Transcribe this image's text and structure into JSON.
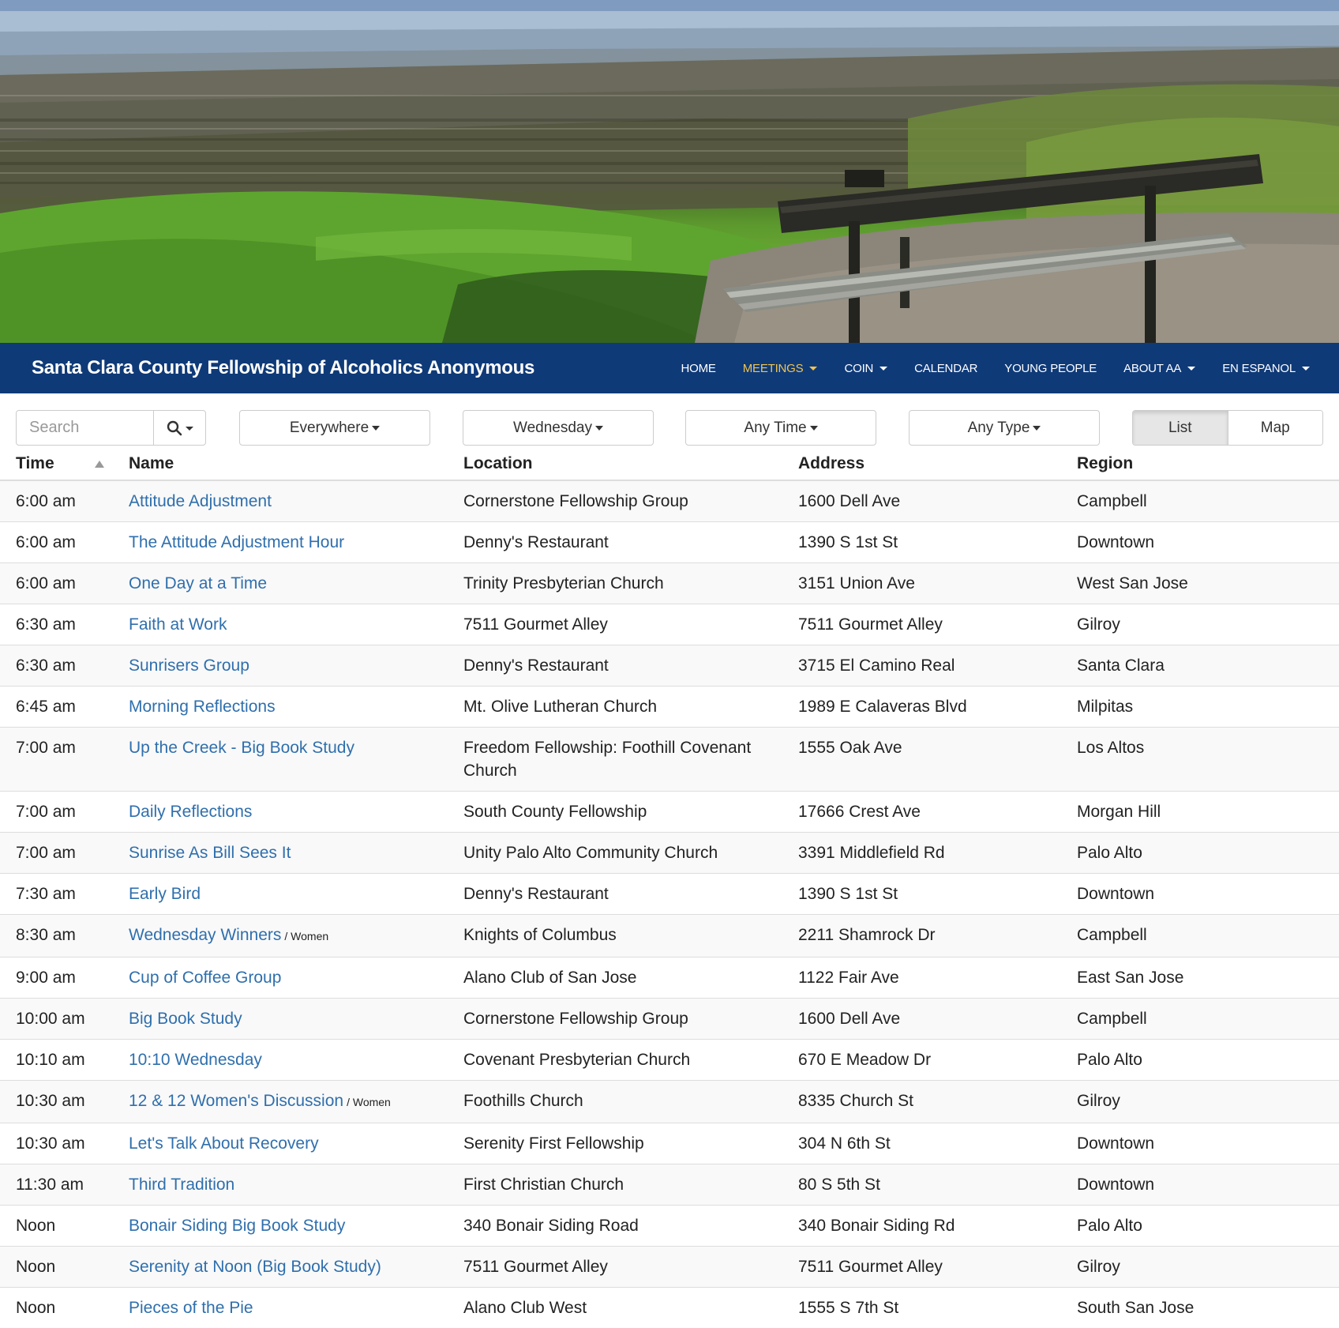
{
  "brand": {
    "title": "Santa Clara County Fellowship of Alcoholics Anonymous"
  },
  "nav": {
    "items": [
      {
        "label": "HOME",
        "dropdown": false,
        "active": false
      },
      {
        "label": "MEETINGS",
        "dropdown": true,
        "active": true
      },
      {
        "label": "COIN",
        "dropdown": true,
        "active": false
      },
      {
        "label": "CALENDAR",
        "dropdown": false,
        "active": false
      },
      {
        "label": "YOUNG PEOPLE",
        "dropdown": false,
        "active": false
      },
      {
        "label": "ABOUT AA",
        "dropdown": true,
        "active": false
      },
      {
        "label": "EN ESPANOL",
        "dropdown": true,
        "active": false
      }
    ],
    "active_color": "#f0c451",
    "bar_color": "#0f3a78"
  },
  "controls": {
    "search_placeholder": "Search",
    "search_icon": "search-icon",
    "region_filter": "Everywhere",
    "day_filter": "Wednesday",
    "time_filter": "Any Time",
    "type_filter": "Any Type",
    "view_list": "List",
    "view_map": "Map",
    "active_view": "List"
  },
  "table": {
    "headers": {
      "time": "Time",
      "name": "Name",
      "location": "Location",
      "address": "Address",
      "region": "Region"
    },
    "sorted_by": "time",
    "link_color": "#2f6fad",
    "rows": [
      {
        "time": "6:00 am",
        "name": "Attitude Adjustment",
        "attr": "",
        "location": "Cornerstone Fellowship Group",
        "address": "1600 Dell Ave",
        "region": "Campbell"
      },
      {
        "time": "6:00 am",
        "name": "The Attitude Adjustment Hour",
        "attr": "",
        "location": "Denny's Restaurant",
        "address": "1390 S 1st St",
        "region": "Downtown"
      },
      {
        "time": "6:00 am",
        "name": "One Day at a Time",
        "attr": "",
        "location": "Trinity Presbyterian Church",
        "address": "3151 Union Ave",
        "region": "West San Jose"
      },
      {
        "time": "6:30 am",
        "name": "Faith at Work",
        "attr": "",
        "location": "7511 Gourmet Alley",
        "address": "7511 Gourmet Alley",
        "region": "Gilroy"
      },
      {
        "time": "6:30 am",
        "name": "Sunrisers Group",
        "attr": "",
        "location": "Denny's Restaurant",
        "address": "3715 El Camino Real",
        "region": "Santa Clara"
      },
      {
        "time": "6:45 am",
        "name": "Morning Reflections",
        "attr": "",
        "location": "Mt. Olive Lutheran Church",
        "address": "1989 E Calaveras Blvd",
        "region": "Milpitas"
      },
      {
        "time": "7:00 am",
        "name": "Up the Creek - Big Book Study",
        "attr": "",
        "location": "Freedom Fellowship: Foothill Covenant Church",
        "address": "1555 Oak Ave",
        "region": "Los Altos"
      },
      {
        "time": "7:00 am",
        "name": "Daily Reflections",
        "attr": "",
        "location": "South County Fellowship",
        "address": "17666 Crest Ave",
        "region": "Morgan Hill"
      },
      {
        "time": "7:00 am",
        "name": "Sunrise As Bill Sees It",
        "attr": "",
        "location": "Unity Palo Alto Community Church",
        "address": "3391 Middlefield Rd",
        "region": "Palo Alto"
      },
      {
        "time": "7:30 am",
        "name": "Early Bird",
        "attr": "",
        "location": "Denny's Restaurant",
        "address": "1390 S 1st St",
        "region": "Downtown"
      },
      {
        "time": "8:30 am",
        "name": "Wednesday Winners",
        "attr": "/ Women",
        "location": "Knights of Columbus",
        "address": "2211 Shamrock Dr",
        "region": "Campbell"
      },
      {
        "time": "9:00 am",
        "name": "Cup of Coffee Group",
        "attr": "",
        "location": "Alano Club of San Jose",
        "address": "1122 Fair Ave",
        "region": "East San Jose"
      },
      {
        "time": "10:00 am",
        "name": "Big Book Study",
        "attr": "",
        "location": "Cornerstone Fellowship Group",
        "address": "1600 Dell Ave",
        "region": "Campbell"
      },
      {
        "time": "10:10 am",
        "name": "10:10 Wednesday",
        "attr": "",
        "location": "Covenant Presbyterian Church",
        "address": "670 E Meadow Dr",
        "region": "Palo Alto"
      },
      {
        "time": "10:30 am",
        "name": "12 & 12 Women's Discussion",
        "attr": "/ Women",
        "location": "Foothills Church",
        "address": "8335 Church St",
        "region": "Gilroy"
      },
      {
        "time": "10:30 am",
        "name": "Let's Talk About Recovery",
        "attr": "",
        "location": "Serenity First Fellowship",
        "address": "304 N 6th St",
        "region": "Downtown"
      },
      {
        "time": "11:30 am",
        "name": "Third Tradition",
        "attr": "",
        "location": "First Christian Church",
        "address": "80 S 5th St",
        "region": "Downtown"
      },
      {
        "time": "Noon",
        "name": "Bonair Siding Big Book Study",
        "attr": "",
        "location": "340 Bonair Siding Road",
        "address": "340 Bonair Siding Rd",
        "region": "Palo Alto"
      },
      {
        "time": "Noon",
        "name": "Serenity at Noon (Big Book Study)",
        "attr": "",
        "location": "7511 Gourmet Alley",
        "address": "7511 Gourmet Alley",
        "region": "Gilroy"
      },
      {
        "time": "Noon",
        "name": "Pieces of the Pie",
        "attr": "",
        "location": "Alano Club West",
        "address": "1555 S 7th St",
        "region": "South San Jose"
      }
    ]
  }
}
